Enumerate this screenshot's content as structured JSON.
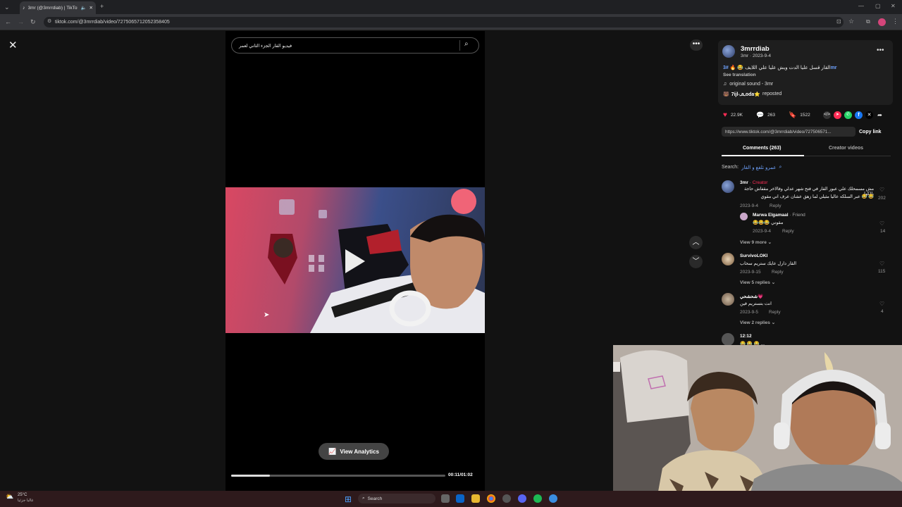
{
  "browser": {
    "tab_title": "3mr (@3mrrdiab) | TikTok",
    "url": "tiktok.com/@3mrrdiab/video/7275065712052358405"
  },
  "player": {
    "search_text": "فيديو القار الجزء الثاني لعمر",
    "analytics_label": "View Analytics",
    "time": "00:11/01:02",
    "progress": 0.18
  },
  "post": {
    "author": "3mrrdiab",
    "meta": "3mr · 2023-9-4",
    "caption": "القار قسل عليا الدت ويش عليا علي اللايف 😂 🔥 ",
    "hashtag": "#3mr",
    "see_translation": "See translation",
    "sound": "original sound - 3mr",
    "reposted_by": "7ijl-ـaـoda⭐",
    "reposted_label": "reposted",
    "likes": "22.9K",
    "comments": "263",
    "saves": "1522",
    "link": "https://www.tiktok.com/@3mrrdiab/video/727506571...",
    "copy_link": "Copy link"
  },
  "tabs": {
    "comments": "Comments (263)",
    "creator_videos": "Creator videos"
  },
  "search_hint": {
    "label": "Search:",
    "query": "عمرو تلفع و القار"
  },
  "comments": [
    {
      "user": "3mr",
      "tag": "Creator",
      "text1": "مش مسمحلك علي عبور القار في فتح شهر عدلي وفالاخر مقفاش حاجة يالكها",
      "text2": "عبر السلكه عاليا مثيلي لما زهق عشان عرف اني مقوي 😂 😂",
      "date": "2023-9-4",
      "reply": "Reply",
      "count": "202"
    },
    {
      "user": "Marwa Elgamaal",
      "tag": "Friend",
      "text1": "😂😂😂 مقوني",
      "date": "2023-9-4",
      "reply": "Reply",
      "count": "14"
    },
    {
      "user": "SurvivoLOKI",
      "text1": "القار دارل عايك ستريم سحاب",
      "date": "2023-9-15",
      "reply": "Reply",
      "count": "115"
    },
    {
      "user": "شحشحي💗",
      "text1": "انت بتستريم فين",
      "date": "2023-9-5",
      "reply": "Reply",
      "count": "4"
    },
    {
      "user": "12:12",
      "text1": "😂 😂 😂 ..."
    }
  ],
  "view_more": {
    "first": "View 9 more",
    "second": "View 5 replies",
    "third": "View 2 replies"
  },
  "taskbar": {
    "weather_temp": "25°C",
    "weather_text": "غالبا جزئيا",
    "search": "Search"
  },
  "colors": {
    "creator_tag": "#fe2c55",
    "hashtag": "#6fa3ff",
    "like": "#fe2c55"
  }
}
